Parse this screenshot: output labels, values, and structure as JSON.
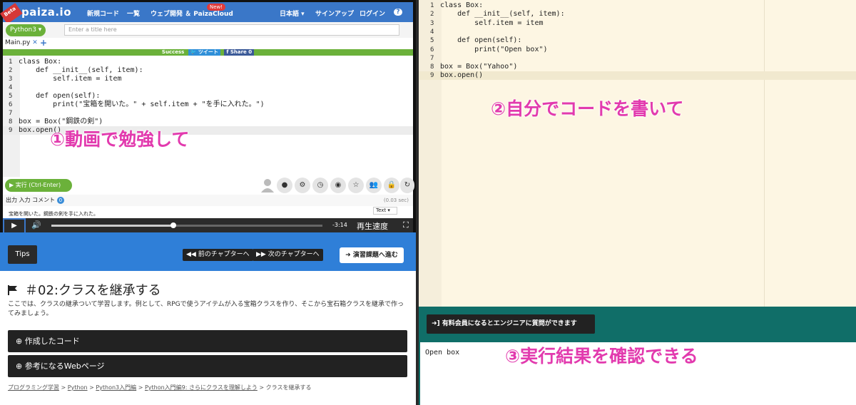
{
  "nav": {
    "beta": "Beta",
    "logo": "paiza.io",
    "links": [
      "新規コード",
      "一覧",
      "ウェブ開発 ＆ PaizaCloud",
      "日本語 ▾",
      "サインアップ",
      "ログイン",
      "?"
    ],
    "new_badge": "New!"
  },
  "editor_left": {
    "language": "Python3",
    "title_placeholder": "Enter a title here",
    "file_tab": "Main.py",
    "file_close": "✕",
    "add_tab": "+",
    "success": "Success",
    "tweet": "ツイート",
    "share": "Share 0",
    "lines": [
      {
        "n": "1",
        "code": "class Box:"
      },
      {
        "n": "2",
        "code": "    def __init__(self, item):"
      },
      {
        "n": "3",
        "code": "        self.item = item"
      },
      {
        "n": "4",
        "code": ""
      },
      {
        "n": "5",
        "code": "    def open(self):"
      },
      {
        "n": "6",
        "code": "        print(\"宝箱を開いた。\" + self.item + \"を手に入れた。\")"
      },
      {
        "n": "7",
        "code": ""
      },
      {
        "n": "8",
        "code": "box = Box(\"鋼鉄の剣\")"
      },
      {
        "n": "9",
        "code": "box.open()"
      }
    ],
    "run_button": "実行 (Ctrl-Enter)",
    "output_tabs": {
      "out": "出力",
      "in": "入力",
      "comment": "コメント",
      "comment_count": "0"
    },
    "time": "(0.03 sec)",
    "text_select": "Text",
    "output_text": "宝箱を開いた。鋼鉄の剣を手に入れた。"
  },
  "player": {
    "progress": 0.45,
    "time_left": "-3:14",
    "speed_label": "再生速度"
  },
  "lesson": {
    "tips": "Tips",
    "prev_chapter": "前のチャプターへ",
    "next_chapter": "次のチャプターへ",
    "exercise": "演習課題へ進む",
    "title": "＃02:クラスを継承する",
    "description": "ここでは、クラスの継承ついて学習します。例として、RPGで使うアイテムが入る宝箱クラスを作り、そこから宝石箱クラスを継承で作ってみましょう。",
    "accordion1": "作成したコード",
    "accordion2": "参考になるWebページ",
    "breadcrumb": [
      "プログラミング学習",
      "Python",
      "Python3入門編",
      "Python入門編9: さらにクラスを理解しよう",
      "クラスを継承する"
    ]
  },
  "editor_right": {
    "lines": [
      {
        "n": "1",
        "code": "class Box:"
      },
      {
        "n": "2",
        "code": "    def __init__(self, item):"
      },
      {
        "n": "3",
        "code": "        self.item = item"
      },
      {
        "n": "4",
        "code": ""
      },
      {
        "n": "5",
        "code": "    def open(self):"
      },
      {
        "n": "6",
        "code": "        print(\"Open box\")"
      },
      {
        "n": "7",
        "code": ""
      },
      {
        "n": "8",
        "code": "box = Box(\"Yahoo\")"
      },
      {
        "n": "9",
        "code": "box.open()"
      }
    ],
    "member_button": "有料会員になるとエンジニアに質問ができます",
    "output": "Open box"
  },
  "annotations": {
    "step1": "①動画で勉強して",
    "step2": "②自分でコードを書いて",
    "step3": "③実行結果を確認できる"
  },
  "colors": {
    "accent_pink": "#e23aae",
    "brand_blue": "#2f7fd8",
    "success_green": "#6bb13a",
    "teal": "#106e68"
  }
}
